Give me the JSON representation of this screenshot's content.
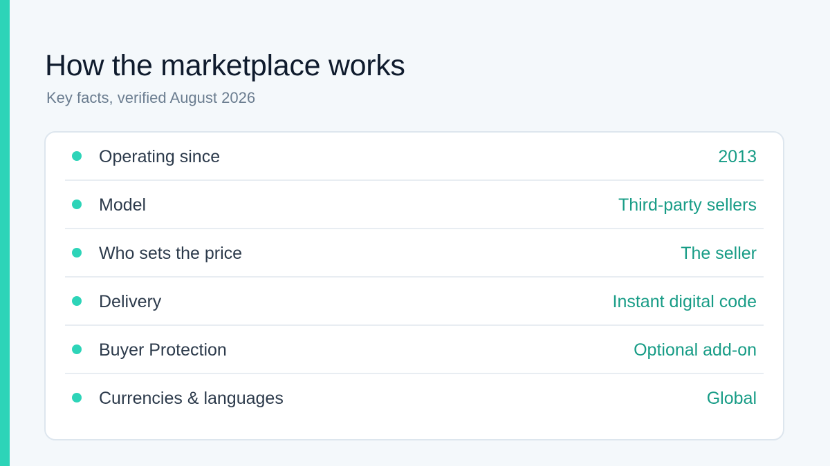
{
  "header": {
    "title": "How the marketplace works",
    "subtitle": "Key facts, verified August 2026"
  },
  "facts": [
    {
      "label": "Operating since",
      "value": "2013"
    },
    {
      "label": "Model",
      "value": "Third-party sellers"
    },
    {
      "label": "Who sets the price",
      "value": "The seller"
    },
    {
      "label": "Delivery",
      "value": "Instant digital code"
    },
    {
      "label": "Buyer Protection",
      "value": "Optional add-on"
    },
    {
      "label": "Currencies & languages",
      "value": "Global"
    }
  ],
  "colors": {
    "accent": "#2dd4b8",
    "value_text": "#179c86",
    "title_text": "#0f1b2d",
    "subtitle_text": "#6b7d90",
    "background": "#f4f8fb"
  },
  "icons": {
    "bullet": "dot-icon"
  }
}
